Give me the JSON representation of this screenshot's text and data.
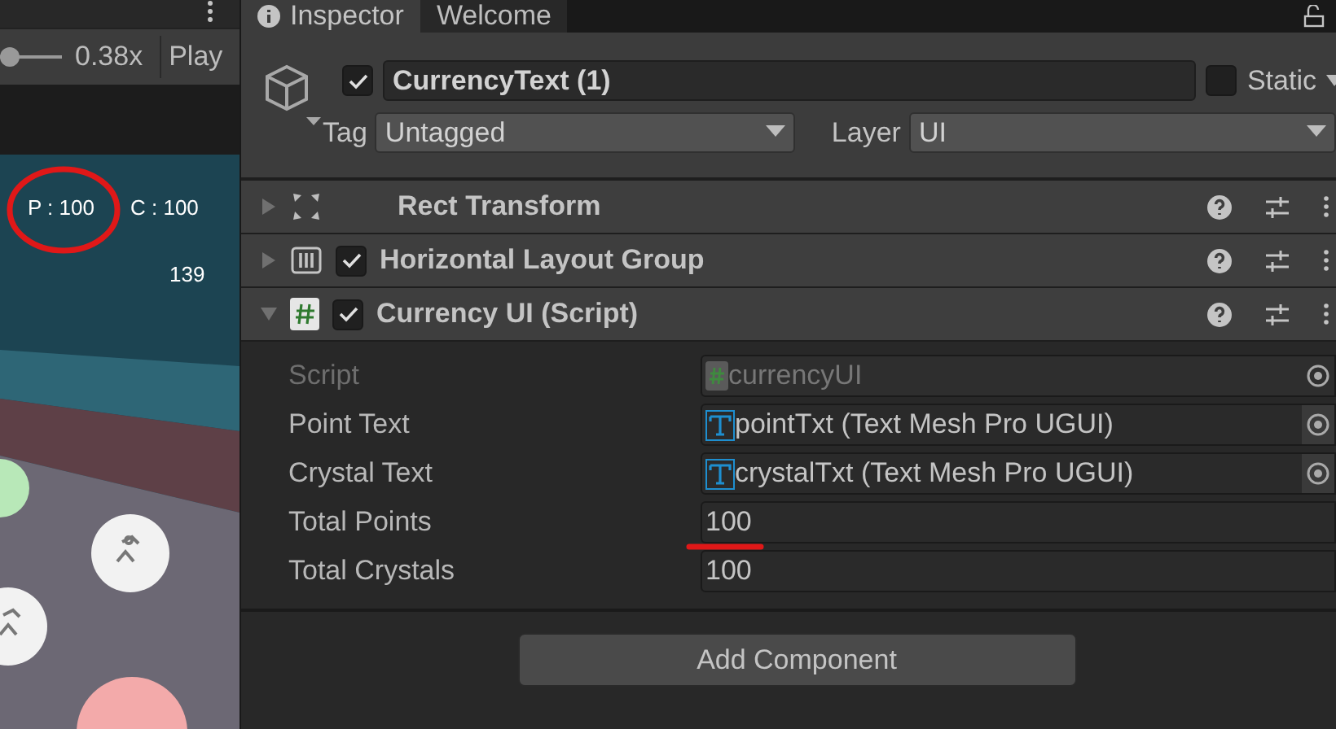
{
  "game_view": {
    "zoom_slider": {
      "level": 0.0
    },
    "zoom_label": "0.38x",
    "play_label": "Play",
    "hud_texts": [
      "P : 100",
      "C : 100",
      "139"
    ]
  },
  "tabs": [
    {
      "label": "Inspector",
      "selected": true
    },
    {
      "label": "Welcome",
      "selected": false
    }
  ],
  "object": {
    "active": true,
    "name": "CurrencyText (1)",
    "static": false,
    "static_label": "Static",
    "tag_label": "Tag",
    "tag": "Untagged",
    "layer_label": "Layer",
    "layer": "UI"
  },
  "components": [
    {
      "kind": "transform",
      "name": "Rect Transform",
      "expanded": false
    },
    {
      "kind": "layout",
      "name": "Horizontal Layout Group",
      "expanded": false,
      "enabled": true
    },
    {
      "kind": "script",
      "name": "Currency UI (Script)",
      "expanded": true,
      "enabled": true
    }
  ],
  "fields": [
    {
      "kind": "script",
      "label": "Script",
      "value": "currencyUI",
      "disabled": true
    },
    {
      "kind": "tmp",
      "label": "Point Text",
      "value": "pointTxt (Text Mesh Pro UGUI)",
      "disabled": false
    },
    {
      "kind": "tmp",
      "label": "Crystal Text",
      "value": "crystalTxt (Text Mesh Pro UGUI)",
      "disabled": false
    },
    {
      "kind": "number",
      "label": "Total Points",
      "value": "100",
      "disabled": false
    },
    {
      "kind": "number",
      "label": "Total Crystals",
      "value": "100",
      "disabled": false
    }
  ],
  "add_button": "Add Component"
}
